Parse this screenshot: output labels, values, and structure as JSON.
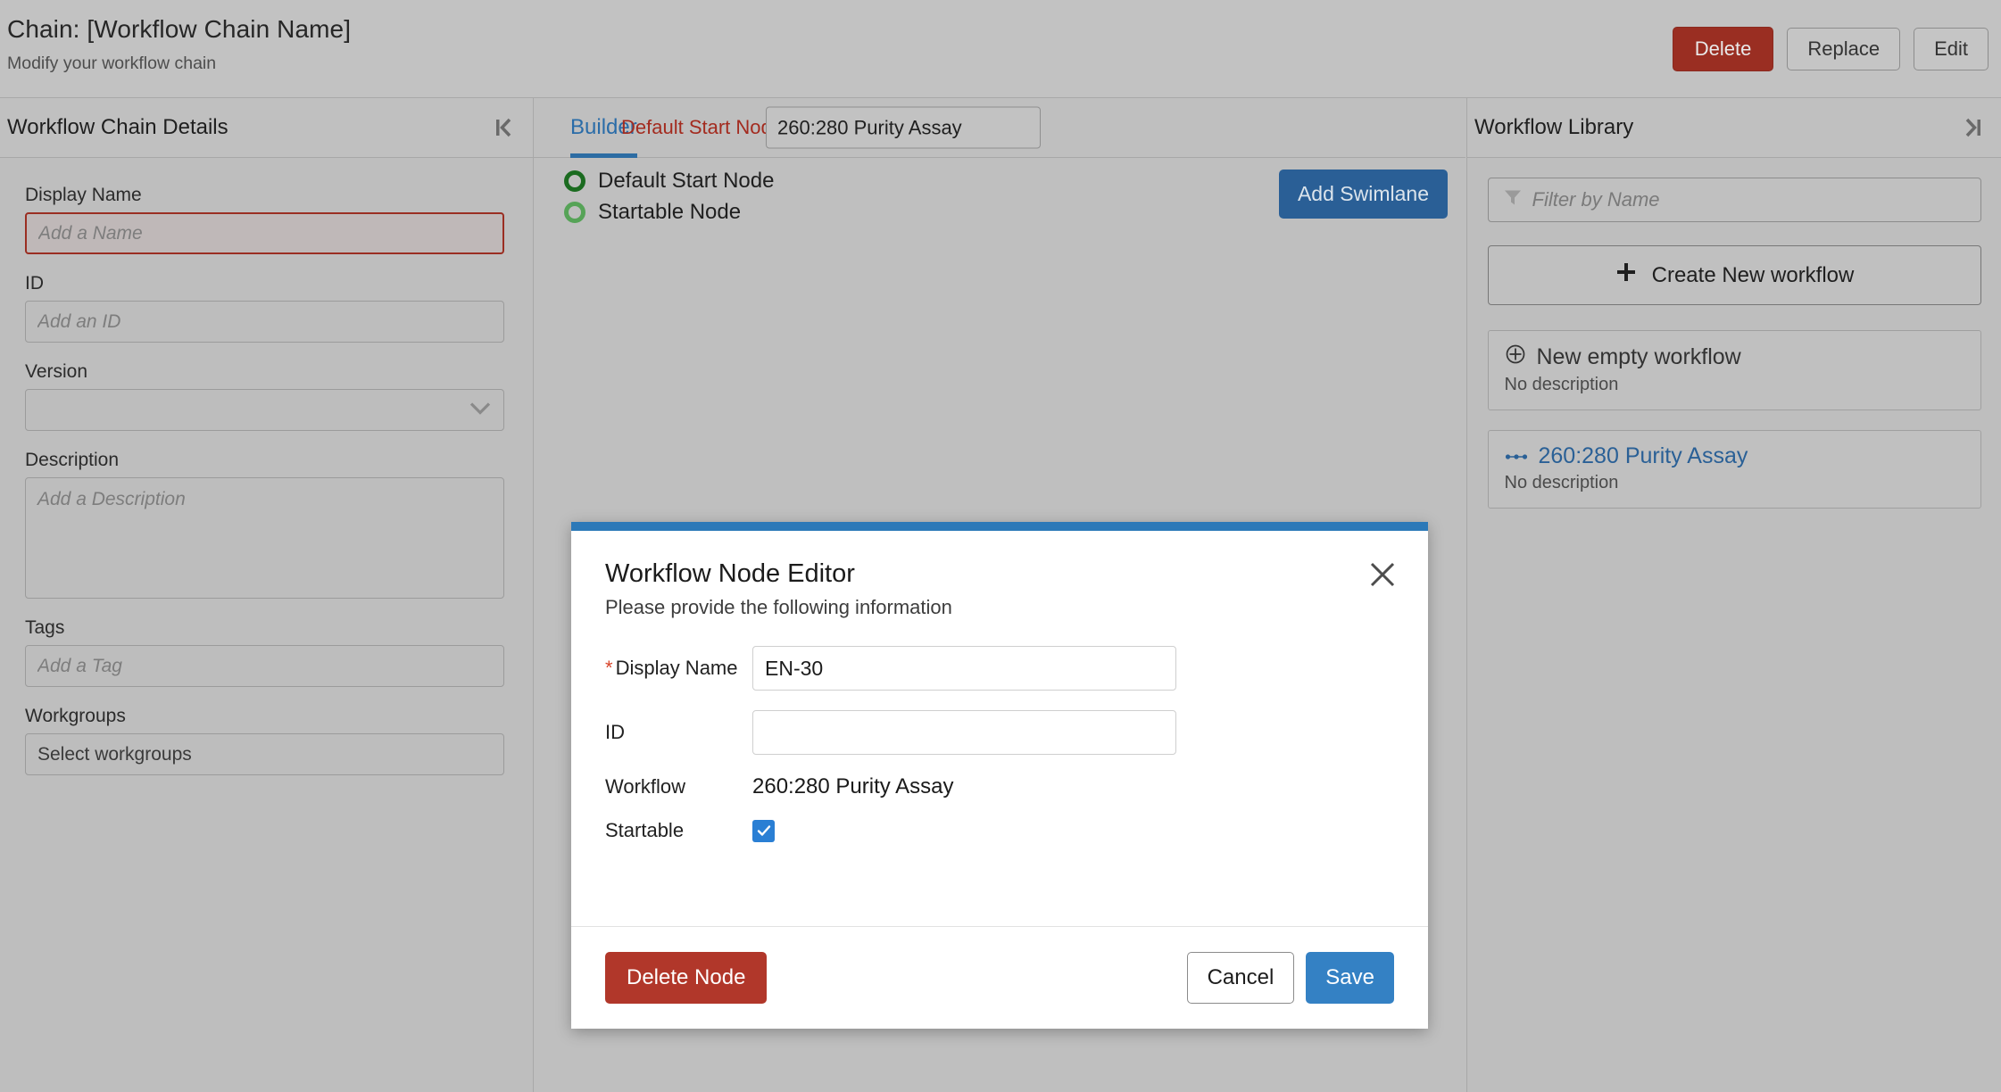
{
  "header": {
    "title": "Chain: [Workflow Chain Name]",
    "subtitle": "Modify your workflow chain",
    "actions": {
      "delete": "Delete",
      "replace": "Replace",
      "edit": "Edit"
    }
  },
  "left_panel": {
    "title": "Workflow Chain Details",
    "collapse_icon": "collapse-left-icon",
    "fields": {
      "display_name": {
        "label": "Display Name",
        "value": "",
        "placeholder": "Add a Name"
      },
      "id": {
        "label": "ID",
        "value": "",
        "placeholder": "Add an ID"
      },
      "version": {
        "label": "Version",
        "value": "",
        "options": []
      },
      "description": {
        "label": "Description",
        "value": "",
        "placeholder": "Add a Description"
      },
      "tags": {
        "label": "Tags",
        "value": "",
        "placeholder": "Add a Tag"
      },
      "workgroups": {
        "label": "Workgroups",
        "value": "Select workgroups"
      }
    }
  },
  "center": {
    "tab": "Builder",
    "default_start_node_label": "Default Start Node:",
    "default_start_node_value": "260:280 Purity Assay",
    "default_start_node_options": [
      "260:280 Purity Assay"
    ],
    "refresh_icon": "refresh-sync-icon",
    "legend": [
      {
        "label": "Default Start Node",
        "color": "#1b6b20"
      },
      {
        "label": "Startable Node",
        "color": "#56a357"
      }
    ],
    "add_swimlane": "Add Swimlane"
  },
  "right_panel": {
    "title": "Workflow Library",
    "collapse_icon": "collapse-right-icon",
    "filter_placeholder": "Filter by Name",
    "filter_value": "",
    "create_button": "Create New workflow",
    "cards": [
      {
        "title": "New empty workflow",
        "description": "No description",
        "icon": "plus-circle-icon",
        "link": false
      },
      {
        "title": "260:280 Purity Assay",
        "description": "No description",
        "icon": "workflow-dots-icon",
        "link": true
      }
    ]
  },
  "modal": {
    "title": "Workflow Node Editor",
    "subtitle": "Please provide the following information",
    "close_icon": "close-icon",
    "fields": {
      "display_name": {
        "label": "Display Name",
        "required_marker": "*",
        "value": "EN-30",
        "placeholder": ""
      },
      "id": {
        "label": "ID",
        "value": "",
        "placeholder": ""
      },
      "workflow": {
        "label": "Workflow",
        "value": "260:280 Purity Assay"
      },
      "startable": {
        "label": "Startable",
        "checked": true
      }
    },
    "buttons": {
      "delete_node": "Delete Node",
      "cancel": "Cancel",
      "save": "Save"
    }
  },
  "colors": {
    "accent_blue": "#2c79b8",
    "danger_red": "#9a2e22",
    "modal_delete_red": "#b1372a",
    "save_blue": "#3481c4",
    "required_red": "#d8452b",
    "start_node_label_red": "#a32b1f"
  }
}
